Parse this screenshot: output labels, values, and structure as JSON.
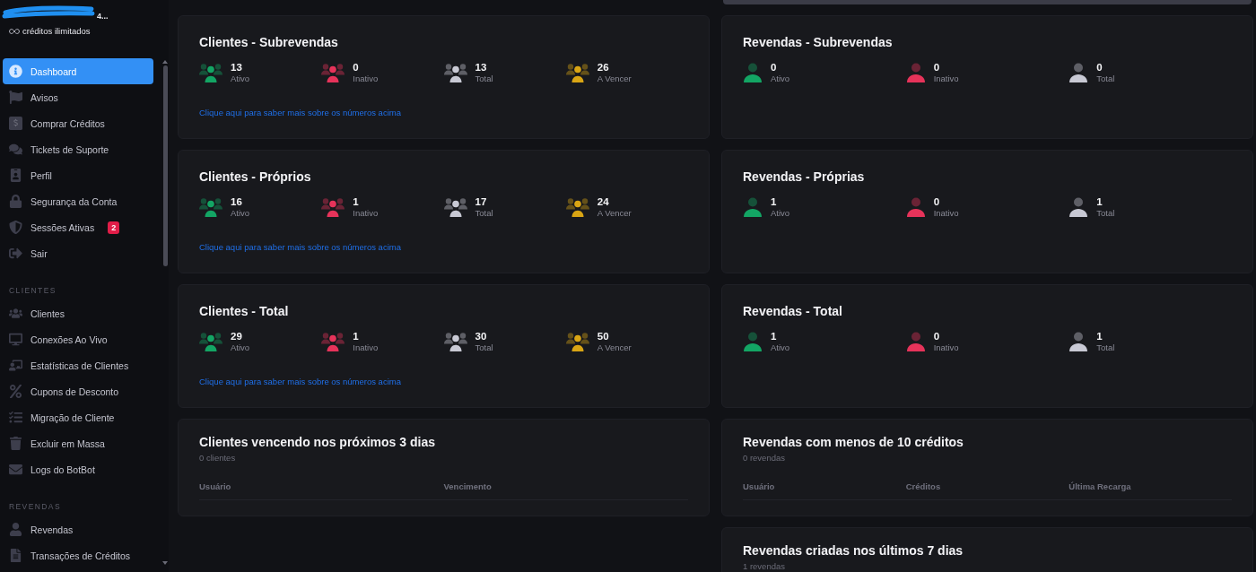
{
  "sidebar": {
    "account": {
      "name": "4...",
      "credits": "créditos ilimitados"
    },
    "sections": [
      {
        "items": [
          {
            "label": "Dashboard",
            "selected": true
          },
          {
            "label": "Avisos",
            "selected": false
          },
          {
            "label": "Comprar Créditos",
            "selected": false
          },
          {
            "label": "Tickets de Suporte",
            "selected": false
          },
          {
            "label": "Perfil",
            "selected": false
          },
          {
            "label": "Segurança da Conta",
            "selected": false
          },
          {
            "label": "Sessões Ativas",
            "selected": false,
            "badge": "2"
          },
          {
            "label": "Sair",
            "selected": false
          }
        ]
      },
      {
        "heading": "CLIENTES",
        "items": [
          {
            "label": "Clientes",
            "selected": false
          },
          {
            "label": "Conexões Ao Vivo",
            "selected": false
          },
          {
            "label": "Estatísticas de Clientes",
            "selected": false
          },
          {
            "label": "Cupons de Desconto",
            "selected": false
          },
          {
            "label": "Migração de Cliente",
            "selected": false
          },
          {
            "label": "Excluir em Massa",
            "selected": false
          },
          {
            "label": "Logs do BotBot",
            "selected": false
          }
        ]
      },
      {
        "heading": "REVENDAS",
        "items": [
          {
            "label": "Revendas",
            "selected": false
          },
          {
            "label": "Transações de Créditos",
            "selected": false
          }
        ]
      }
    ]
  },
  "columns": [
    {
      "cards": [
        {
          "kind": "clients",
          "title": "Clientes - Subrevendas",
          "stats": [
            {
              "value": "13",
              "label": "Ativo",
              "color": "#13a564"
            },
            {
              "value": "0",
              "label": "Inativo",
              "color": "#e6335a"
            },
            {
              "value": "13",
              "label": "Total",
              "color": "#c8c9d4"
            },
            {
              "value": "26",
              "label": "A Vencer",
              "color": "#d9a514"
            }
          ],
          "link": "Clique aqui para saber mais sobre os números acima"
        },
        {
          "kind": "clients",
          "title": "Clientes - Próprios",
          "stats": [
            {
              "value": "16",
              "label": "Ativo",
              "color": "#13a564"
            },
            {
              "value": "1",
              "label": "Inativo",
              "color": "#e6335a"
            },
            {
              "value": "17",
              "label": "Total",
              "color": "#c8c9d4"
            },
            {
              "value": "24",
              "label": "A Vencer",
              "color": "#d9a514"
            }
          ],
          "link": "Clique aqui para saber mais sobre os números acima"
        },
        {
          "kind": "clients",
          "title": "Clientes - Total",
          "stats": [
            {
              "value": "29",
              "label": "Ativo",
              "color": "#13a564"
            },
            {
              "value": "1",
              "label": "Inativo",
              "color": "#e6335a"
            },
            {
              "value": "30",
              "label": "Total",
              "color": "#c8c9d4"
            },
            {
              "value": "50",
              "label": "A Vencer",
              "color": "#d9a514"
            }
          ],
          "link": "Clique aqui para saber mais sobre os números acima"
        },
        {
          "kind": "table",
          "title": "Clientes vencendo nos próximos 3 dias",
          "subtitle": "0 clientes",
          "columns": [
            "Usuário",
            "Vencimento"
          ]
        }
      ]
    },
    {
      "cards": [
        {
          "kind": "resellers",
          "title": "Revendas - Subrevendas",
          "stats": [
            {
              "value": "0",
              "label": "Ativo",
              "color": "#13a564"
            },
            {
              "value": "0",
              "label": "Inativo",
              "color": "#e6335a"
            },
            {
              "value": "0",
              "label": "Total",
              "color": "#c8c9d4"
            }
          ]
        },
        {
          "kind": "resellers",
          "title": "Revendas - Próprias",
          "stats": [
            {
              "value": "1",
              "label": "Ativo",
              "color": "#13a564"
            },
            {
              "value": "0",
              "label": "Inativo",
              "color": "#e6335a"
            },
            {
              "value": "1",
              "label": "Total",
              "color": "#c8c9d4"
            }
          ]
        },
        {
          "kind": "resellers",
          "title": "Revendas - Total",
          "stats": [
            {
              "value": "1",
              "label": "Ativo",
              "color": "#13a564"
            },
            {
              "value": "0",
              "label": "Inativo",
              "color": "#e6335a"
            },
            {
              "value": "1",
              "label": "Total",
              "color": "#c8c9d4"
            }
          ]
        },
        {
          "kind": "table",
          "title": "Revendas com menos de 10 créditos",
          "subtitle": "0 revendas",
          "columns": [
            "Usuário",
            "Créditos",
            "Última Recarga"
          ]
        },
        {
          "kind": "table",
          "title": "Revendas criadas nos últimos 7 dias",
          "subtitle": "1 revendas"
        }
      ]
    }
  ]
}
